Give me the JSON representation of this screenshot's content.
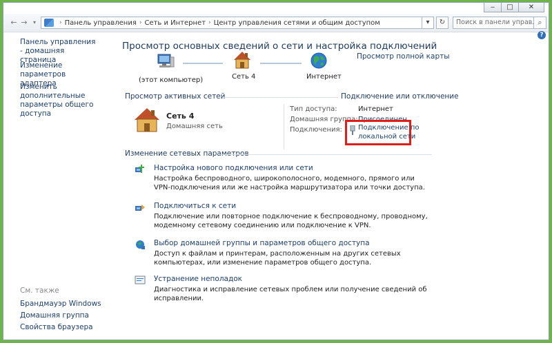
{
  "window": {
    "controls": [
      "‒",
      "□",
      "✕"
    ]
  },
  "address_bar": {
    "crumbs": [
      "Панель управления",
      "Сеть и Интернет",
      "Центр управления сетями и общим доступом"
    ],
    "search_placeholder": "Поиск в панели управления"
  },
  "sidebar": {
    "links": [
      "Панель управления - домашняя страница",
      "Изменение параметров адаптера",
      "Изменить дополнительные параметры общего доступа"
    ],
    "see_also_header": "См. также",
    "see_also": [
      "Брандмауэр Windows",
      "Домашняя группа",
      "Свойства браузера"
    ]
  },
  "main": {
    "title": "Просмотр основных сведений о сети и настройка подключений",
    "full_map_link": "Просмотр полной карты",
    "network_map": {
      "computer": "(этот компьютер)",
      "network": "Сеть 4",
      "internet": "Интернет"
    },
    "active_networks": {
      "header": "Просмотр активных сетей",
      "connect_disconnect": "Подключение или отключение",
      "network_name": "Сеть 4",
      "network_type": "Домашняя сеть",
      "access_type_label": "Тип доступа:",
      "access_type_value": "Интернет",
      "homegroup_label": "Домашняя группа:",
      "homegroup_value": "Присоединен",
      "connections_label": "Подключения:",
      "connections_value_line1": "Подключение по",
      "connections_value_line2": "локальной сети"
    },
    "change_settings": {
      "header": "Изменение сетевых параметров",
      "tasks": [
        {
          "title": "Настройка нового подключения или сети",
          "desc": "Настройка беспроводного, широкополосного, модемного, прямого или VPN-подключения или же настройка маршрутизатора или точки доступа."
        },
        {
          "title": "Подключиться к сети",
          "desc": "Подключение или повторное подключение к беспроводному, проводному, модемному сетевому соединению или подключение к VPN."
        },
        {
          "title": "Выбор домашней группы и параметров общего доступа",
          "desc": "Доступ к файлам и принтерам, расположенным на других сетевых компьютерах, или изменение параметров общего доступа."
        },
        {
          "title": "Устранение неполадок",
          "desc": "Диагностика и исправление сетевых проблем или получение сведений об исправлении."
        }
      ]
    }
  },
  "colors": {
    "link": "#1e3f6e",
    "highlight": "#e21b1b"
  }
}
